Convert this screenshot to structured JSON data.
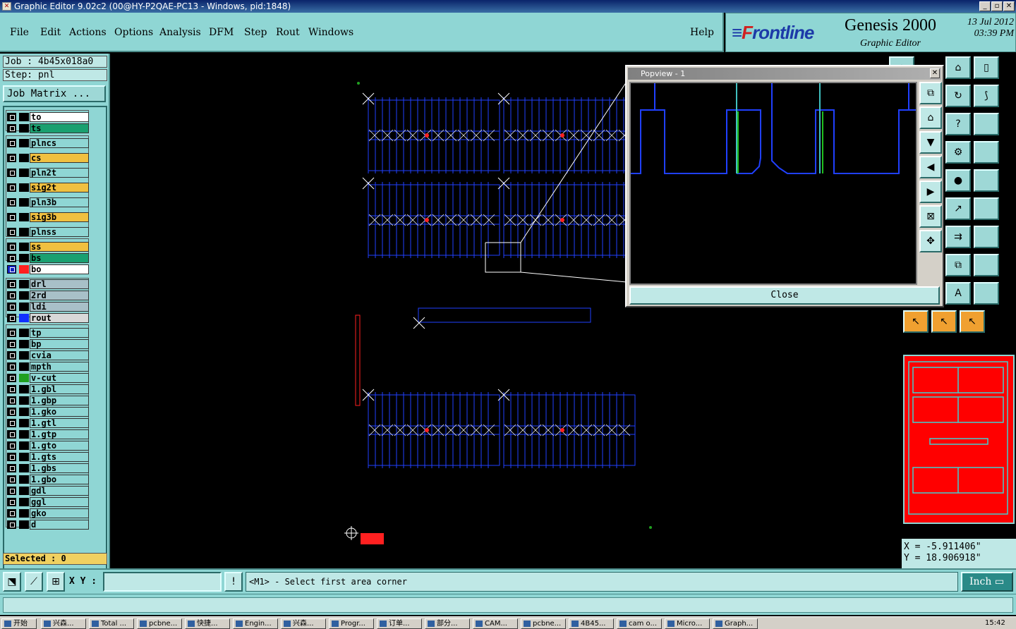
{
  "window": {
    "title": "Graphic Editor 9.02c2 (00@HY-P2QAE-PC13 - Windows, pid:1848)"
  },
  "menu": [
    "File",
    "Edit",
    "Actions",
    "Options",
    "Analysis",
    "DFM",
    "Step",
    "Rout",
    "Windows"
  ],
  "help_label": "Help",
  "brand": {
    "logo_pre": "F",
    "logo_text": "rontline",
    "product": "Genesis 2000",
    "subtitle": "Graphic Editor",
    "date": "13 Jul 2012",
    "time": "03:39 PM"
  },
  "job": {
    "job_label": "Job : 4b45x018a0",
    "step_label": "Step: pnl",
    "job_matrix_label": "Job Matrix ..."
  },
  "layers": [
    {
      "name": "to",
      "color": "#ffffff"
    },
    {
      "name": "ts",
      "color": "#1aa070"
    },
    {
      "name": "plncs",
      "color": "#8fd6d4"
    },
    {
      "name": "cs",
      "color": "#f0c040"
    },
    {
      "name": "pln2t",
      "color": "#8fd6d4"
    },
    {
      "name": "sig2t",
      "color": "#f0c040"
    },
    {
      "name": "pln3b",
      "color": "#8fd6d4"
    },
    {
      "name": "sig3b",
      "color": "#f0c040"
    },
    {
      "name": "plnss",
      "color": "#8fd6d4"
    },
    {
      "name": "ss",
      "color": "#f0c040"
    },
    {
      "name": "bs",
      "color": "#1aa070"
    },
    {
      "name": "bo",
      "color": "#ffffff"
    },
    {
      "name": "drl",
      "color": "#a8c0c8"
    },
    {
      "name": "2rd",
      "color": "#a8c0c8"
    },
    {
      "name": "ldi",
      "color": "#a8c0c8"
    },
    {
      "name": "rout",
      "color": "#d8d8d8"
    },
    {
      "name": "tp",
      "color": "#8fd6d4"
    },
    {
      "name": "bp",
      "color": "#8fd6d4"
    },
    {
      "name": "cvia",
      "color": "#8fd6d4"
    },
    {
      "name": "mpth",
      "color": "#8fd6d4"
    },
    {
      "name": "v-cut",
      "color": "#8fd6d4"
    },
    {
      "name": "1.gbl",
      "color": "#8fd6d4"
    },
    {
      "name": "1.gbp",
      "color": "#8fd6d4"
    },
    {
      "name": "1.gko",
      "color": "#8fd6d4"
    },
    {
      "name": "1.gtl",
      "color": "#8fd6d4"
    },
    {
      "name": "1.gtp",
      "color": "#8fd6d4"
    },
    {
      "name": "1.gto",
      "color": "#8fd6d4"
    },
    {
      "name": "1.gts",
      "color": "#8fd6d4"
    },
    {
      "name": "1.gbs",
      "color": "#8fd6d4"
    },
    {
      "name": "1.gbo",
      "color": "#8fd6d4"
    },
    {
      "name": "gdl",
      "color": "#8fd6d4"
    },
    {
      "name": "ggl",
      "color": "#8fd6d4"
    },
    {
      "name": "gko",
      "color": "#8fd6d4"
    },
    {
      "name": "d",
      "color": "#8fd6d4"
    }
  ],
  "selected_label": "Selected : 0",
  "coords": {
    "x": "X = -5.911406\"",
    "y": "Y = 18.906918\""
  },
  "bottom": {
    "xy_label": "X Y :",
    "xy_value": "",
    "prompt": "<M1> - Select first area corner",
    "unit": "Inch"
  },
  "popview": {
    "title": "Popview - 1",
    "close_label": "Close"
  },
  "taskbar": {
    "start": "开始",
    "tasks": [
      "兴森...",
      "Total ...",
      "pcbne...",
      "快捷...",
      "Engin...",
      "兴森...",
      "Progr...",
      "订单...",
      "部分...",
      "CAM...",
      "pcbne...",
      "4B45...",
      "cam o...",
      "Micro...",
      "Graph..."
    ],
    "clock": "15:42"
  }
}
